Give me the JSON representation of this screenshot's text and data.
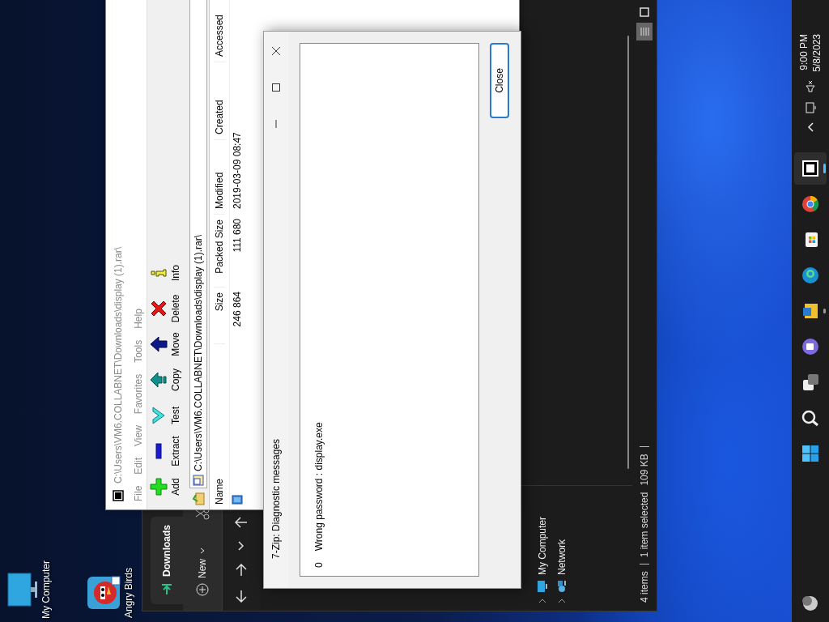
{
  "desktop_icons": [
    {
      "kind": "computer",
      "label": "My Computer"
    },
    {
      "kind": "game",
      "label": "Angry Birds"
    }
  ],
  "explorer": {
    "tab_title": "Downloads",
    "new_button": "New",
    "nav_items": [
      {
        "kind": "computer",
        "label": "My Computer"
      },
      {
        "kind": "network",
        "label": "Network"
      }
    ],
    "status_bar": [
      "4 items",
      "1 item selected",
      "109 KB"
    ],
    "views": [
      {
        "kind": "details",
        "selected": true
      },
      {
        "kind": "tiles",
        "selected": false
      }
    ]
  },
  "zip_window": {
    "title": "C:\\Users\\VM6.COLLABNET\\Downloads\\display (1).rar\\",
    "menu": [
      "File",
      "Edit",
      "View",
      "Favorites",
      "Tools",
      "Help"
    ],
    "toolbar": [
      {
        "kind": "add",
        "label": "Add"
      },
      {
        "kind": "extract",
        "label": "Extract"
      },
      {
        "kind": "test",
        "label": "Test"
      },
      {
        "kind": "copy",
        "label": "Copy"
      },
      {
        "kind": "move",
        "label": "Move"
      },
      {
        "kind": "delete",
        "label": "Delete"
      },
      {
        "kind": "info",
        "label": "Info"
      }
    ],
    "address": "C:\\Users\\VM6.COLLABNET\\Downloads\\display (1).rar\\",
    "columns": [
      "Name",
      "Size",
      "Packed Size",
      "Modified",
      "Created",
      "Accessed"
    ],
    "rows": [
      {
        "size": "246 864",
        "packed_size": "111 680",
        "modified": "2019-03-09 08:47"
      }
    ]
  },
  "dialog": {
    "title": "7-Zip: Diagnostic messages",
    "messages": [
      {
        "index": "0",
        "text": "Wrong password : display.exe"
      }
    ],
    "close_button": "Close"
  },
  "taskbar": {
    "apps": [
      {
        "kind": "start",
        "selected": false,
        "running": false
      },
      {
        "kind": "search",
        "selected": false,
        "running": false
      },
      {
        "kind": "taskview",
        "selected": false,
        "running": false
      },
      {
        "kind": "chat",
        "selected": false,
        "running": false
      },
      {
        "kind": "explorer",
        "selected": false,
        "running": true
      },
      {
        "kind": "edge",
        "selected": false,
        "running": false
      },
      {
        "kind": "store",
        "selected": false,
        "running": false
      },
      {
        "kind": "chrome",
        "selected": false,
        "running": false
      },
      {
        "kind": "archiver",
        "selected": true,
        "running": true
      }
    ],
    "time": "9:00 PM",
    "date": "5/8/2023"
  }
}
